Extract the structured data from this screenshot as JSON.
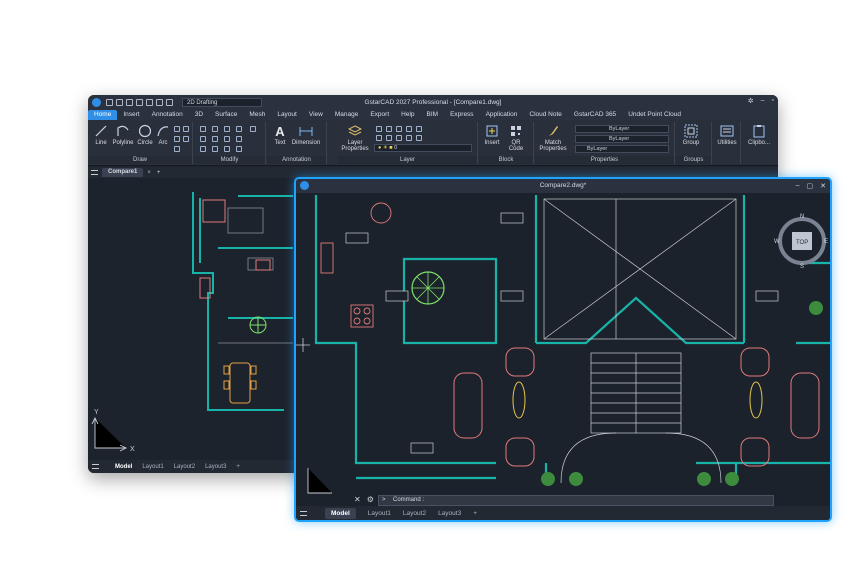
{
  "main_window": {
    "title": "GstarCAD 2027 Professional - [Compare1.dwg]",
    "workspace": "2D Drafting",
    "menu": [
      "Home",
      "Insert",
      "Annotation",
      "3D",
      "Surface",
      "Mesh",
      "Layout",
      "View",
      "Manage",
      "Export",
      "Help",
      "BIM",
      "Express",
      "Application",
      "Cloud Note",
      "GstarCAD 365",
      "Undet Point Cloud"
    ],
    "ribbon": {
      "draw_tools": [
        "Line",
        "Polyline",
        "Circle",
        "Arc"
      ],
      "draw_panel": "Draw",
      "modify_panel": "Modify",
      "text_tool": "Text",
      "dimension_tool": "Dimension",
      "annotation_panel": "Annotation",
      "layer_properties": "Layer\nProperties",
      "layer_current": "0",
      "layer_panel": "Layer",
      "insert_tool": "Insert",
      "qr_tool": "QR\nCode",
      "block_panel": "Block",
      "match_tool": "Match\nProperties",
      "bylayer": [
        "ByLayer",
        "ByLayer",
        "ByLayer"
      ],
      "properties_panel": "Properties",
      "group_tool": "Group",
      "groups_panel": "Groups",
      "utilities_tool": "Utilities",
      "clipboard_tool": "Clipbo..."
    },
    "file_tab": "Compare1",
    "layouts": [
      "Model",
      "Layout1",
      "Layout2",
      "Layout3"
    ],
    "axis": {
      "y": "Y",
      "x": "X"
    }
  },
  "compare_window": {
    "title": "Compare2.dwg*",
    "command_prompt": "Command :",
    "layouts": [
      "Model",
      "Layout1",
      "Layout2",
      "Layout3"
    ],
    "viewcube": {
      "top": "TOP",
      "n": "N",
      "s": "S",
      "w": "W",
      "e": "E"
    }
  },
  "colors": {
    "accent": "#2f8fe6",
    "glow": "#1fa3ff",
    "wall": "#18b3a8",
    "furniture": "#e07a7a",
    "plant": "#7ee06a",
    "lines": "#c9ccd4"
  }
}
